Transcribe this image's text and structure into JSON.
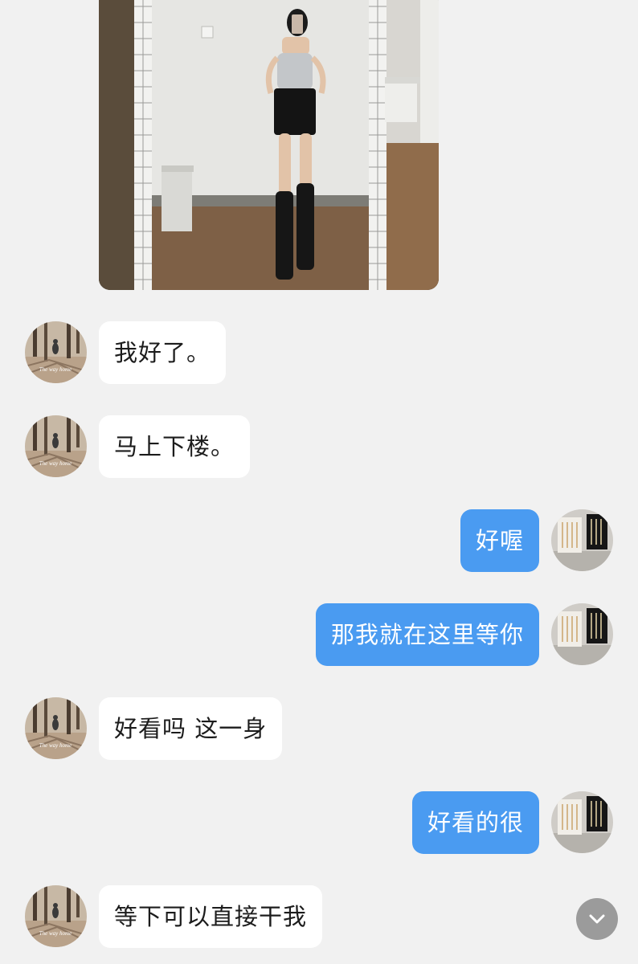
{
  "chat": {
    "messages": [
      {
        "from": "contact",
        "kind": "image"
      },
      {
        "from": "contact",
        "kind": "text",
        "text": "我好了。"
      },
      {
        "from": "contact",
        "kind": "text",
        "text": "马上下楼。"
      },
      {
        "from": "me",
        "kind": "text",
        "text": "好喔"
      },
      {
        "from": "me",
        "kind": "text",
        "text": "那我就在这里等你"
      },
      {
        "from": "contact",
        "kind": "text",
        "text": "好看吗 这一身"
      },
      {
        "from": "me",
        "kind": "text",
        "text": "好看的很"
      },
      {
        "from": "contact",
        "kind": "text",
        "text": "等下可以直接干我"
      }
    ]
  },
  "contact_avatar": {
    "caption": "The way home"
  },
  "controls": {
    "scroll_down_icon": "chevron-down-icon"
  },
  "colors": {
    "background": "#f1f1f1",
    "incoming_bubble": "#ffffff",
    "outgoing_bubble": "#4a9bf1",
    "scroll_button": "#9b9b9b"
  }
}
